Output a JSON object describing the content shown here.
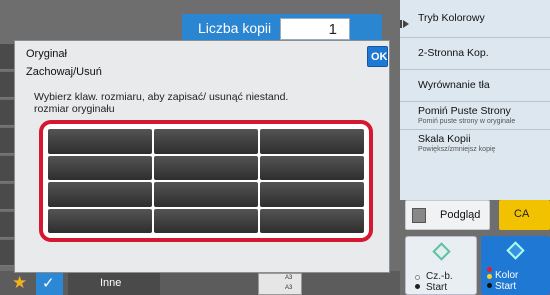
{
  "header": {
    "copies_label": "Liczba kopii",
    "copies_value": "1"
  },
  "right_panel": {
    "items": [
      {
        "title": "Tryb Kolorowy",
        "subtitle": ""
      },
      {
        "title": "2-Stronna Kop.",
        "subtitle": ""
      },
      {
        "title": "Wyrównanie tła",
        "subtitle": ""
      },
      {
        "title": "Pomiń Puste Strony",
        "subtitle": "Pomiń puste strony w oryginale"
      },
      {
        "title": "Skala Kopii",
        "subtitle": "Powiększ/zmniejsz kopię"
      }
    ]
  },
  "buttons": {
    "preview_label": "Podgląd",
    "ca_label": "CA",
    "start_bw_line1": "Cz.-b.",
    "start_bw_line2": "Start",
    "start_color_line1": "Kolor",
    "start_color_line2": "Start"
  },
  "bottom_bar": {
    "other_label": "Inne",
    "thumb_top": "A3",
    "thumb_bottom": "A3"
  },
  "dialog": {
    "title": "Oryginał",
    "subtitle": "Zachowaj/Usuń",
    "ok_label": "OK",
    "description": "Wybierz klaw. rozmiaru, aby zapisać/ usunąć niestand. rozmiar oryginału",
    "size_keys": [
      {
        "label": ""
      },
      {
        "label": ""
      },
      {
        "label": ""
      },
      {
        "label": ""
      },
      {
        "label": ""
      },
      {
        "label": ""
      },
      {
        "label": ""
      },
      {
        "label": ""
      },
      {
        "label": ""
      },
      {
        "label": ""
      },
      {
        "label": ""
      },
      {
        "label": ""
      }
    ]
  },
  "colors": {
    "accent_blue": "#1f78d4",
    "highlight_red": "#d4182f",
    "ca_yellow": "#f2c200",
    "star": "#f2b21f"
  }
}
